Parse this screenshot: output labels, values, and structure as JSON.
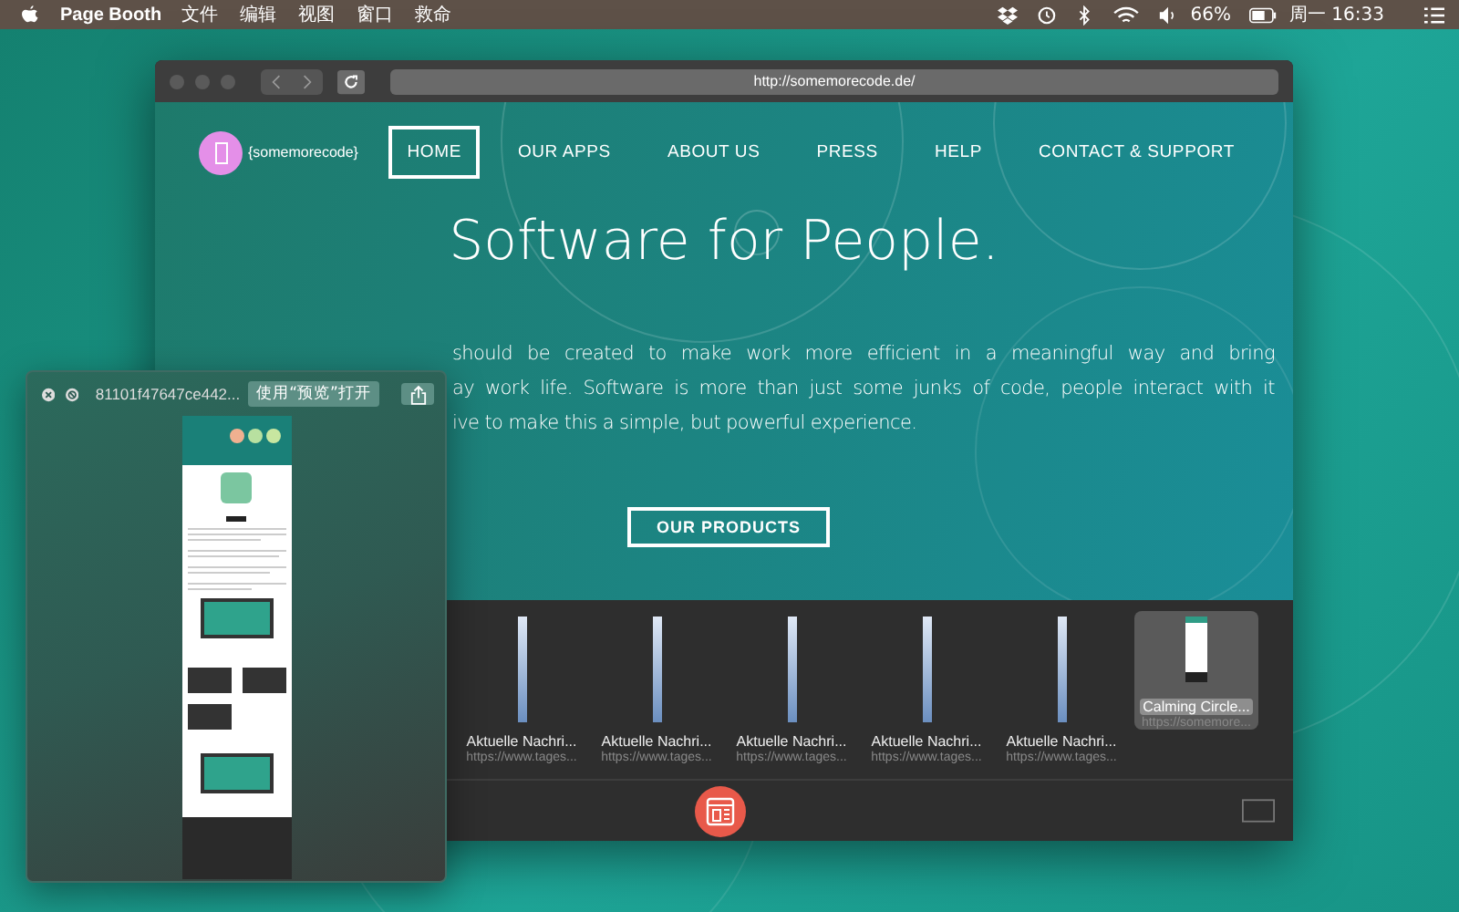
{
  "menu_bar": {
    "app_name": "Page Booth",
    "menus": [
      "文件",
      "编辑",
      "视图",
      "窗口",
      "救命"
    ],
    "battery_percent": "66%",
    "clock": "周一 16:33"
  },
  "browser": {
    "url": "http://somemorecode.de/",
    "site": {
      "logo_text": "{somemorecode}",
      "nav": [
        {
          "label": "HOME",
          "selected": true
        },
        {
          "label": "OUR APPS",
          "selected": false
        },
        {
          "label": "ABOUT US",
          "selected": false
        },
        {
          "label": "PRESS",
          "selected": false
        },
        {
          "label": "HELP",
          "selected": false
        },
        {
          "label": "CONTACT & SUPPORT",
          "selected": false
        }
      ],
      "headline": "Software for People.",
      "paragraph_lines": [
        "should be created to make work more efficient in a meaningful way and bring",
        "ay work life. Software is more than just some junks of code, people interact with it",
        "ive to make this a simple, but powerful experience."
      ],
      "cta": "OUR PRODUCTS"
    }
  },
  "shelf": {
    "items": [
      {
        "title": "Aktuelle Nachri...",
        "url": "https://www.tages...",
        "selected": false
      },
      {
        "title": "Aktuelle Nachri...",
        "url": "https://www.tages...",
        "selected": false
      },
      {
        "title": "Aktuelle Nachri...",
        "url": "https://www.tages...",
        "selected": false
      },
      {
        "title": "Aktuelle Nachri...",
        "url": "https://www.tages...",
        "selected": false
      },
      {
        "title": "Aktuelle Nachri...",
        "url": "https://www.tages...",
        "selected": false
      },
      {
        "title": "Calming Circle...",
        "url": "https://somemore...",
        "selected": true
      }
    ]
  },
  "preview_panel": {
    "filename": "81101f47647ce442...",
    "open_button": "使用“预览”打开"
  }
}
